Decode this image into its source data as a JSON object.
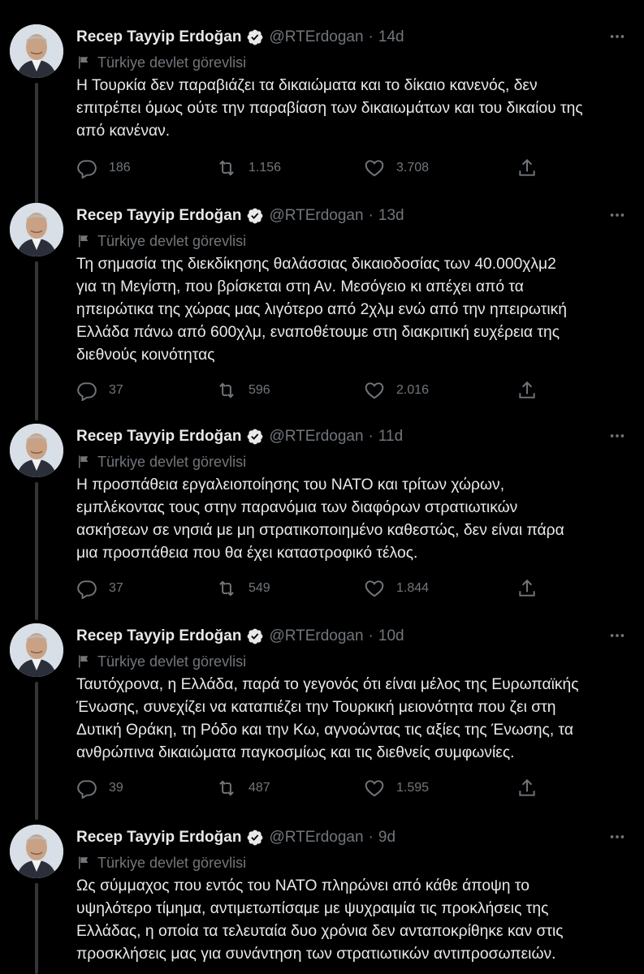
{
  "colors": {
    "background": "#000000",
    "text": "#e7e9ea",
    "muted": "#71767b",
    "verified": "#e7e9ea",
    "thread_line": "#333639"
  },
  "tweets": [
    {
      "name": "Recep Tayyip Erdoğan",
      "handle": "@RTErdogan",
      "separator": "·",
      "time": "14d",
      "label": "Türkiye devlet görevlisi",
      "text": "Η Τουρκία δεν παραβιάζει  τα δικαιώματα και το δίκαιο κανενός, δεν\nεπιτρέπει όμως ούτε την παραβίαση των δικαιωμάτων και του δικαίου της\nαπό κανέναν.",
      "replies": "186",
      "retweets": "1.156",
      "likes": "3.708"
    },
    {
      "name": "Recep Tayyip Erdoğan",
      "handle": "@RTErdogan",
      "separator": "·",
      "time": "13d",
      "label": "Türkiye devlet görevlisi",
      "text": "Τη σημασία της διεκδίκησης θαλάσσιας δικαιοδοσίας των 40.000χλμ2\nγια τη Μεγίστη, που βρίσκεται στη Αν. Μεσόγειο κι απέχει από τα\nηπειρώτικα της χώρας μας λιγότερο από 2χλμ ενώ από την ηπειρωτική\nΕλλάδα πάνω από 600χλμ, εναποθέτουμε στη διακριτική ευχέρεια της\nδιεθνούς κοινότητας",
      "replies": "37",
      "retweets": "596",
      "likes": "2.016"
    },
    {
      "name": "Recep Tayyip Erdoğan",
      "handle": "@RTErdogan",
      "separator": "·",
      "time": "11d",
      "label": "Türkiye devlet görevlisi",
      "text": "Η προσπάθεια εργαλειοποίησης του ΝΑΤΟ και τρίτων χώρων,\nεμπλέκοντας τους στην παρανόμια των διαφόρων στρατιωτικών\nασκήσεων σε νησιά με μη στρατικοποιημένο καθεστώς, δεν είναι πάρα\nμια προσπάθεια που θα έχει καταστροφικό τέλος.",
      "replies": "37",
      "retweets": "549",
      "likes": "1.844"
    },
    {
      "name": "Recep Tayyip Erdoğan",
      "handle": "@RTErdogan",
      "separator": "·",
      "time": "10d",
      "label": "Türkiye devlet görevlisi",
      "text": "Ταυτόχρονα, η Ελλάδα, παρά το γεγονός ότι είναι μέλος της Ευρωπαϊκής\nΈνωσης, συνεχίζει να καταπιέζει την Τουρκική μειονότητα που ζει στη\nΔυτική Θράκη, τη Ρόδο και την Κω, αγνοώντας τις αξίες της Ένωσης, τα\nανθρώπινα δικαιώματα παγκοσμίως και τις διεθνείς συμφωνίες.",
      "replies": "39",
      "retweets": "487",
      "likes": "1.595"
    },
    {
      "name": "Recep Tayyip Erdoğan",
      "handle": "@RTErdogan",
      "separator": "·",
      "time": "9d",
      "label": "Türkiye devlet görevlisi",
      "text": "Ως σύμμαχος που εντός του ΝΑΤΟ πληρώνει από κάθε άποψη το\nυψηλότερο τίμημα, αντιμετωπίσαμε με ψυχραιμία τις προκλήσεις της\nΕλλάδας, η οποία τα τελευταία δυο χρόνια δεν ανταποκρίθηκε καν στις\nπροσκλήσεις μας για συνάντηση των στρατιωτικών αντιπροσωπειών."
    }
  ]
}
